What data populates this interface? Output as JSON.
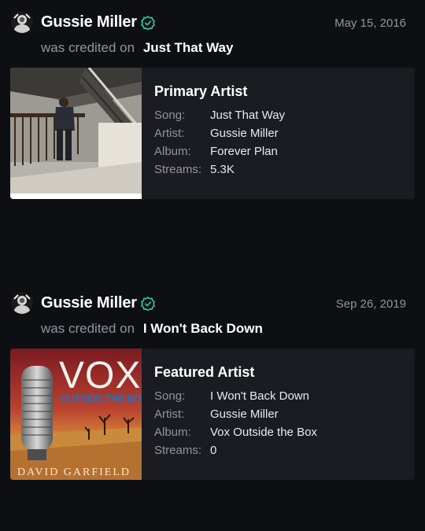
{
  "feed": [
    {
      "artist_name": "Gussie Miller",
      "date": "May 15, 2016",
      "credited_text": "was credited on",
      "song_title": "Just That Way",
      "role": "Primary Artist",
      "details": [
        {
          "label": "Song:",
          "value": "Just That Way"
        },
        {
          "label": "Artist:",
          "value": "Gussie Miller"
        },
        {
          "label": "Album:",
          "value": "Forever Plan"
        },
        {
          "label": "Streams:",
          "value": "5.3K"
        }
      ]
    },
    {
      "artist_name": "Gussie Miller",
      "date": "Sep 26, 2019",
      "credited_text": "was credited on",
      "song_title": "I Won't Back Down",
      "role": "Featured Artist",
      "details": [
        {
          "label": "Song:",
          "value": "I Won't Back Down"
        },
        {
          "label": "Artist:",
          "value": "Gussie Miller"
        },
        {
          "label": "Album:",
          "value": "Vox Outside the Box"
        },
        {
          "label": "Streams:",
          "value": "0"
        }
      ],
      "album_art": {
        "title": "VOX",
        "subtitle": "OUTSIDE THE BOX",
        "artist": "DAVID GARFIELD"
      }
    }
  ],
  "colors": {
    "background": "#0e0f13",
    "card": "#1b1c21",
    "muted": "#8f95a0",
    "verified": "#2fc9a5"
  }
}
